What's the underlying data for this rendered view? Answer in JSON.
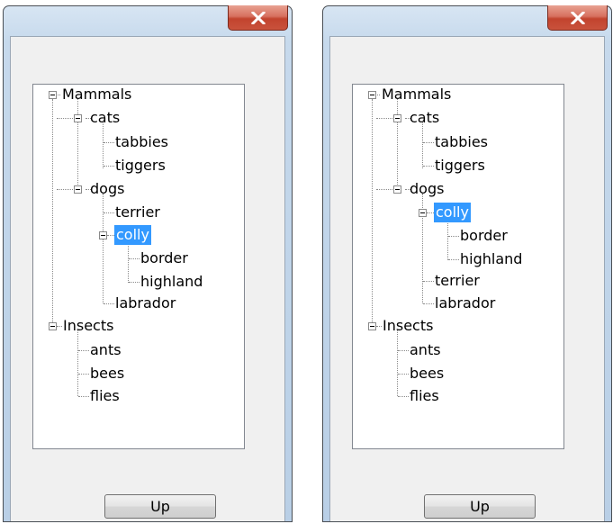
{
  "left_window": {
    "close_label": "close",
    "up_label": "Up",
    "tree": {
      "mammals": "Mammals",
      "cats": "cats",
      "tabbies": "tabbies",
      "tiggers": "tiggers",
      "dogs": "dogs",
      "terrier": "terrier",
      "colly": "colly",
      "border": "border",
      "highland": "highland",
      "labrador": "labrador",
      "insects": "Insects",
      "ants": "ants",
      "bees": "bees",
      "flies": "flies"
    },
    "selected": "colly"
  },
  "right_window": {
    "close_label": "close",
    "up_label": "Up",
    "tree": {
      "mammals": "Mammals",
      "cats": "cats",
      "tabbies": "tabbies",
      "tiggers": "tiggers",
      "dogs": "dogs",
      "colly": "colly",
      "border": "border",
      "highland": "highland",
      "terrier": "terrier",
      "labrador": "labrador",
      "insects": "Insects",
      "ants": "ants",
      "bees": "bees",
      "flies": "flies"
    },
    "selected": "colly"
  },
  "colors": {
    "selection": "#3399ff",
    "close_button": "#c9523c"
  }
}
